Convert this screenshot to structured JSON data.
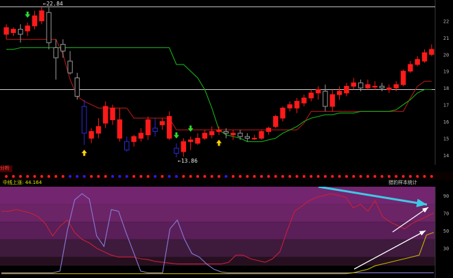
{
  "upper_panel": {
    "high_marker": "22.84",
    "low_marker": "13.86",
    "price_axis": [
      "22",
      "21",
      "20",
      "19",
      "18",
      "17",
      "16",
      "15",
      "14"
    ],
    "side_tab": "分析"
  },
  "lower_panel": {
    "indicator_label": "中线上涨: 44.164",
    "right_label": "猎豹样本统计",
    "axis": [
      "90",
      "70",
      "50",
      "30"
    ]
  },
  "colors": {
    "up_candle": "#ff1a1a",
    "down_candle_bottom": "#2b2bd6",
    "doji": "#9a9a9a",
    "red_line": "#b01818",
    "green_line": "#16b016",
    "purple_line": "#8a7cd6",
    "yellow_line": "#c8b400",
    "cyan_arrow": "#3ec9e6",
    "white_arrow": "#ffffff",
    "bg_purple": "#6b2466"
  },
  "chart_data": {
    "type": "candlestick",
    "ylim": [
      13.5,
      23
    ],
    "hlines": [
      22.84,
      17.9
    ],
    "candles": [
      {
        "o": 21.2,
        "h": 21.8,
        "l": 20.9,
        "c": 21.6,
        "dir": "up"
      },
      {
        "o": 21.3,
        "h": 21.6,
        "l": 21.1,
        "c": 21.5,
        "dir": "up"
      },
      {
        "o": 21.5,
        "h": 21.8,
        "l": 20.7,
        "c": 21.2,
        "dir": "down"
      },
      {
        "o": 21.4,
        "h": 21.9,
        "l": 21.1,
        "c": 21.7,
        "dir": "up"
      },
      {
        "o": 21.7,
        "h": 22.6,
        "l": 21.5,
        "c": 22.3,
        "dir": "up"
      },
      {
        "o": 22.0,
        "h": 22.84,
        "l": 21.8,
        "c": 22.6,
        "dir": "up"
      },
      {
        "o": 22.5,
        "h": 22.8,
        "l": 20.3,
        "c": 20.7,
        "dir": "down"
      },
      {
        "o": 20.4,
        "h": 20.9,
        "l": 18.5,
        "c": 19.8,
        "dir": "down"
      },
      {
        "o": 20.6,
        "h": 20.9,
        "l": 19.8,
        "c": 20.2,
        "dir": "down"
      },
      {
        "o": 19.6,
        "h": 20.2,
        "l": 18.8,
        "c": 18.9,
        "dir": "down"
      },
      {
        "o": 18.6,
        "h": 18.9,
        "l": 17.3,
        "c": 17.5,
        "dir": "down"
      },
      {
        "o": 16.9,
        "h": 17.3,
        "l": 14.6,
        "c": 15.3,
        "dir": "down"
      },
      {
        "o": 15.0,
        "h": 15.6,
        "l": 14.7,
        "c": 15.4,
        "dir": "up"
      },
      {
        "o": 15.3,
        "h": 16.2,
        "l": 15.0,
        "c": 15.7,
        "dir": "up"
      },
      {
        "o": 15.9,
        "h": 17.2,
        "l": 15.6,
        "c": 16.9,
        "dir": "up"
      },
      {
        "o": 16.8,
        "h": 17.0,
        "l": 15.8,
        "c": 16.1,
        "dir": "down"
      },
      {
        "o": 16.1,
        "h": 16.8,
        "l": 14.8,
        "c": 15.0,
        "dir": "down"
      },
      {
        "o": 14.8,
        "h": 15.1,
        "l": 14.2,
        "c": 14.3,
        "dir": "down"
      },
      {
        "o": 14.8,
        "h": 15.2,
        "l": 14.5,
        "c": 15.1,
        "dir": "up"
      },
      {
        "o": 15.0,
        "h": 15.6,
        "l": 14.8,
        "c": 15.3,
        "dir": "up"
      },
      {
        "o": 15.2,
        "h": 16.3,
        "l": 14.9,
        "c": 16.1,
        "dir": "up"
      },
      {
        "o": 15.6,
        "h": 16.2,
        "l": 15.1,
        "c": 15.4,
        "dir": "down"
      },
      {
        "o": 15.8,
        "h": 16.2,
        "l": 15.5,
        "c": 16.0,
        "dir": "up"
      },
      {
        "o": 16.3,
        "h": 16.6,
        "l": 14.9,
        "c": 15.0,
        "dir": "down"
      },
      {
        "o": 14.4,
        "h": 14.7,
        "l": 13.86,
        "c": 14.1,
        "dir": "down"
      },
      {
        "o": 14.2,
        "h": 15.0,
        "l": 13.9,
        "c": 14.8,
        "dir": "up"
      },
      {
        "o": 14.8,
        "h": 15.1,
        "l": 14.3,
        "c": 14.9,
        "dir": "up"
      },
      {
        "o": 14.7,
        "h": 15.3,
        "l": 14.6,
        "c": 15.0,
        "dir": "up"
      },
      {
        "o": 15.0,
        "h": 15.5,
        "l": 14.9,
        "c": 15.3,
        "dir": "up"
      },
      {
        "o": 15.2,
        "h": 15.7,
        "l": 15.0,
        "c": 15.4,
        "dir": "up"
      },
      {
        "o": 15.4,
        "h": 15.7,
        "l": 15.2,
        "c": 15.5,
        "dir": "up"
      },
      {
        "o": 15.4,
        "h": 15.6,
        "l": 15.0,
        "c": 15.3,
        "dir": "down"
      },
      {
        "o": 15.2,
        "h": 15.5,
        "l": 14.9,
        "c": 15.3,
        "dir": "up"
      },
      {
        "o": 15.3,
        "h": 15.5,
        "l": 14.9,
        "c": 15.1,
        "dir": "down"
      },
      {
        "o": 15.1,
        "h": 15.3,
        "l": 14.8,
        "c": 15.0,
        "dir": "down"
      },
      {
        "o": 15.0,
        "h": 15.2,
        "l": 14.9,
        "c": 15.0,
        "dir": "up"
      },
      {
        "o": 15.0,
        "h": 15.5,
        "l": 14.9,
        "c": 15.4,
        "dir": "up"
      },
      {
        "o": 15.4,
        "h": 15.7,
        "l": 15.2,
        "c": 15.6,
        "dir": "up"
      },
      {
        "o": 15.7,
        "h": 16.4,
        "l": 15.6,
        "c": 16.3,
        "dir": "up"
      },
      {
        "o": 16.2,
        "h": 16.9,
        "l": 16.0,
        "c": 16.8,
        "dir": "up"
      },
      {
        "o": 16.8,
        "h": 17.2,
        "l": 16.6,
        "c": 17.0,
        "dir": "up"
      },
      {
        "o": 16.8,
        "h": 17.4,
        "l": 16.5,
        "c": 17.2,
        "dir": "up"
      },
      {
        "o": 17.1,
        "h": 17.6,
        "l": 16.9,
        "c": 17.4,
        "dir": "up"
      },
      {
        "o": 17.4,
        "h": 17.9,
        "l": 17.2,
        "c": 17.7,
        "dir": "up"
      },
      {
        "o": 17.7,
        "h": 18.1,
        "l": 17.3,
        "c": 17.9,
        "dir": "up"
      },
      {
        "o": 17.8,
        "h": 18.2,
        "l": 16.6,
        "c": 16.9,
        "dir": "down"
      },
      {
        "o": 16.9,
        "h": 17.9,
        "l": 16.6,
        "c": 17.6,
        "dir": "up"
      },
      {
        "o": 17.6,
        "h": 18.1,
        "l": 17.3,
        "c": 17.8,
        "dir": "up"
      },
      {
        "o": 17.7,
        "h": 18.3,
        "l": 17.5,
        "c": 18.1,
        "dir": "up"
      },
      {
        "o": 18.1,
        "h": 18.6,
        "l": 17.9,
        "c": 18.3,
        "dir": "up"
      },
      {
        "o": 18.3,
        "h": 18.5,
        "l": 17.8,
        "c": 18.0,
        "dir": "down"
      },
      {
        "o": 18.0,
        "h": 18.5,
        "l": 17.9,
        "c": 18.2,
        "dir": "up"
      },
      {
        "o": 18.1,
        "h": 18.4,
        "l": 17.9,
        "c": 18.1,
        "dir": "up"
      },
      {
        "o": 18.1,
        "h": 18.3,
        "l": 17.8,
        "c": 18.0,
        "dir": "down"
      },
      {
        "o": 17.9,
        "h": 18.2,
        "l": 17.7,
        "c": 18.0,
        "dir": "up"
      },
      {
        "o": 18.0,
        "h": 18.4,
        "l": 17.8,
        "c": 18.2,
        "dir": "up"
      },
      {
        "o": 18.2,
        "h": 19.1,
        "l": 18.1,
        "c": 19.0,
        "dir": "up"
      },
      {
        "o": 19.0,
        "h": 19.6,
        "l": 18.9,
        "c": 19.4,
        "dir": "up"
      },
      {
        "o": 19.4,
        "h": 19.9,
        "l": 19.3,
        "c": 19.7,
        "dir": "up"
      },
      {
        "o": 19.6,
        "h": 20.3,
        "l": 19.5,
        "c": 20.1,
        "dir": "up"
      },
      {
        "o": 20.0,
        "h": 20.6,
        "l": 19.9,
        "c": 20.3,
        "dir": "up"
      }
    ],
    "red_line": [
      20.9,
      20.9,
      20.9,
      20.9,
      20.9,
      20.9,
      20.9,
      20.9,
      20.0,
      18.5,
      17.5,
      17.2,
      17.0,
      16.8,
      16.8,
      16.8,
      16.8,
      16.8,
      16.2,
      16.2,
      16.2,
      16.2,
      16.2,
      16.2,
      15.5,
      15.5,
      15.5,
      15.5,
      15.5,
      15.5,
      15.5,
      15.5,
      15.5,
      15.5,
      15.5,
      15.5,
      15.5,
      15.5,
      15.5,
      15.5,
      15.5,
      15.5,
      15.9,
      16.6,
      16.6,
      16.6,
      16.6,
      16.6,
      16.6,
      16.6,
      16.6,
      16.6,
      16.6,
      16.6,
      16.6,
      16.6,
      16.6,
      17.4,
      18.1,
      18.4,
      18.4
    ],
    "green_line": [
      20.3,
      20.3,
      20.4,
      20.4,
      20.4,
      20.4,
      20.4,
      20.4,
      20.4,
      20.4,
      20.4,
      20.4,
      20.4,
      20.4,
      20.4,
      20.4,
      20.4,
      20.4,
      20.4,
      20.4,
      20.4,
      20.4,
      20.4,
      20.4,
      19.4,
      19.4,
      19.0,
      18.6,
      17.9,
      16.8,
      15.5,
      15.2,
      15.1,
      15.0,
      14.8,
      14.8,
      14.8,
      14.9,
      15.0,
      15.3,
      15.5,
      15.7,
      16.0,
      16.2,
      16.3,
      16.4,
      16.4,
      16.5,
      16.5,
      16.5,
      16.6,
      16.6,
      16.6,
      16.6,
      16.6,
      16.7,
      17.0,
      17.3,
      17.7,
      17.9,
      17.9
    ],
    "up_signals_at": [
      11,
      30
    ],
    "down_signals_at": [
      3,
      24,
      26
    ],
    "lower_indicator": {
      "ylim": [
        0,
        100
      ],
      "red": [
        72,
        72,
        74,
        72,
        70,
        66,
        58,
        44,
        55,
        62,
        48,
        40,
        36,
        30,
        26,
        22,
        20,
        20,
        20,
        18,
        17,
        15,
        14,
        13,
        12,
        12,
        12,
        12,
        12,
        12,
        12,
        14,
        22,
        22,
        18,
        16,
        14,
        18,
        26,
        50,
        72,
        78,
        84,
        88,
        90,
        92,
        90,
        88,
        76,
        80,
        72,
        84,
        66,
        60,
        56,
        52,
        58,
        62,
        66,
        70
      ],
      "purple": [
        2,
        2,
        2,
        2,
        2,
        2,
        2,
        2,
        4,
        50,
        85,
        92,
        86,
        44,
        32,
        74,
        72,
        48,
        26,
        4,
        2,
        2,
        2,
        52,
        62,
        40,
        24,
        20,
        12,
        6,
        3,
        2,
        2,
        2,
        2,
        2,
        2,
        2,
        2,
        2,
        2,
        2,
        2,
        2,
        2,
        2,
        2,
        2,
        2,
        2,
        2,
        2,
        2,
        2,
        2,
        2,
        2,
        2,
        2,
        2
      ],
      "yellow": [
        1,
        1,
        1,
        1,
        1,
        1,
        1,
        1,
        1,
        1,
        1,
        1,
        1,
        1,
        1,
        1,
        1,
        1,
        1,
        1,
        1,
        1,
        1,
        1,
        1,
        1,
        1,
        1,
        1,
        1,
        1,
        1,
        1,
        1,
        1,
        1,
        1,
        1,
        1,
        1,
        1,
        1,
        1,
        1,
        1,
        1,
        1,
        1,
        2,
        4,
        6,
        10,
        12,
        14,
        16,
        18,
        20,
        22,
        45,
        48
      ]
    }
  }
}
